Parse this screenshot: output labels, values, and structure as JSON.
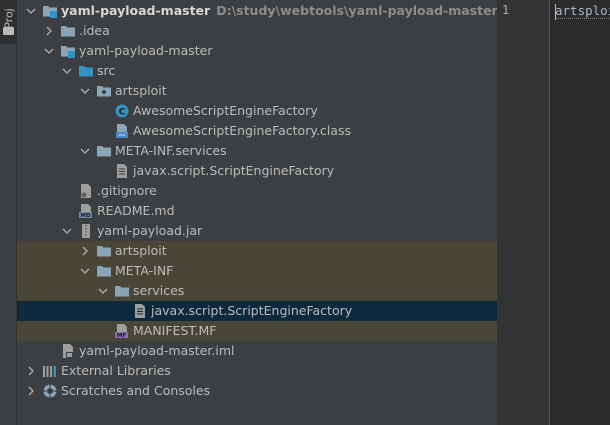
{
  "side_panel": {
    "tab_label": "Proj"
  },
  "tree": {
    "root": {
      "name": "yaml-payload-master",
      "path": "D:\\study\\webtools\\yaml-payload-master"
    },
    "idea": ".idea",
    "module": "yaml-payload-master",
    "src": "src",
    "artsploit": "artsploit",
    "factory_java": "AwesomeScriptEngineFactory",
    "factory_class": "AwesomeScriptEngineFactory.class",
    "meta_services": "META-INF.services",
    "service_file": "javax.script.ScriptEngineFactory",
    "gitignore": ".gitignore",
    "readme": "README.md",
    "jar": "yaml-payload.jar",
    "jar_artsploit": "artsploit",
    "jar_meta": "META-INF",
    "jar_services": "services",
    "jar_service_file": "javax.script.ScriptEngineFactory",
    "manifest": "MANIFEST.MF",
    "iml": "yaml-payload-master.iml",
    "external_libraries": "External Libraries",
    "scratches": "Scratches and Consoles"
  },
  "editor": {
    "line_number": "1",
    "code": "artsploit"
  },
  "colors": {
    "folder": "#8aa4b8",
    "accent_blue": "#3592c4",
    "selection": "#0d293e",
    "highlight": "#4a4637"
  }
}
